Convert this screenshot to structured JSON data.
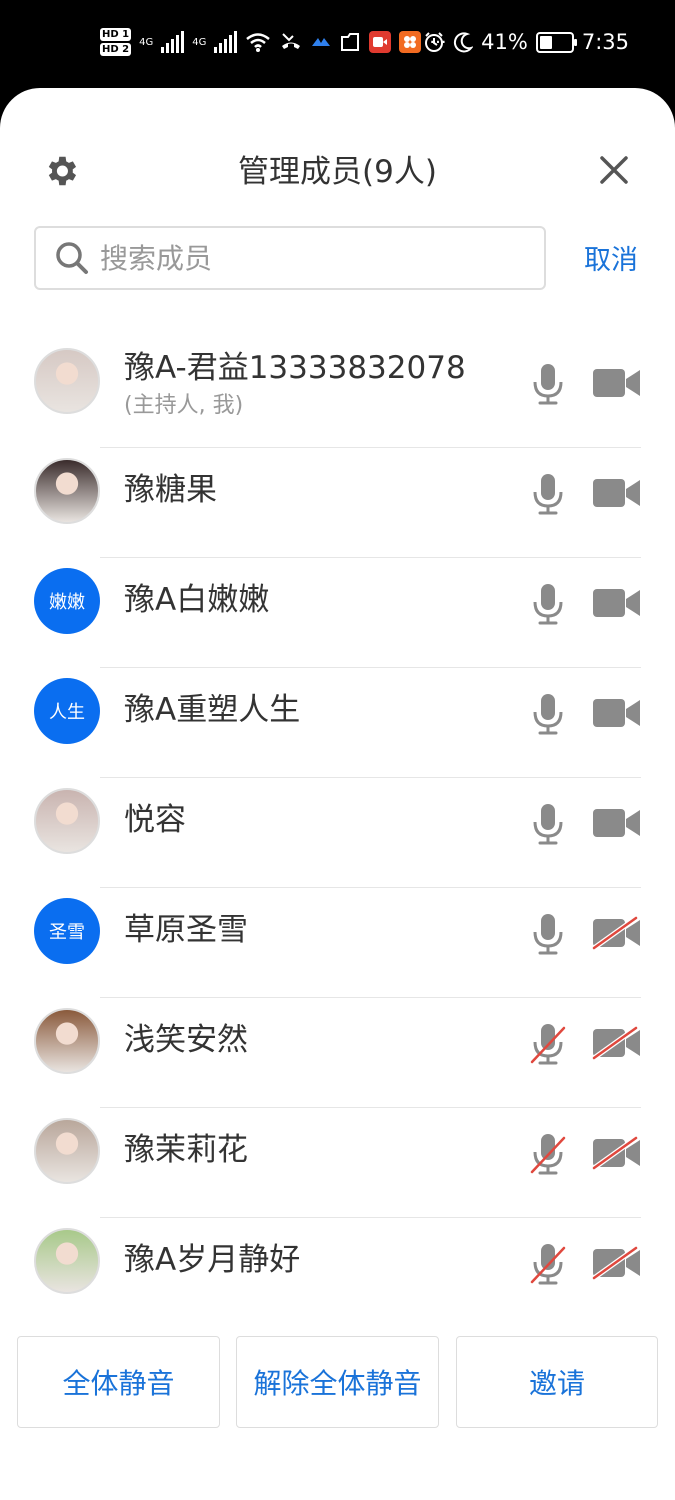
{
  "status_bar": {
    "hd1": "HD 1",
    "hd2": "HD 2",
    "net1": "4G",
    "net2": "4G",
    "more": "···",
    "battery_percent": "41%",
    "battery_level": 0.41,
    "time": "7:35",
    "icons": [
      "signal-icon",
      "wifi-icon",
      "missed-call-icon",
      "app-icon",
      "folder-icon",
      "video-app-icon",
      "app-icon",
      "alarm-icon",
      "moon-icon",
      "battery-icon"
    ]
  },
  "header": {
    "title": "管理成员(9人)",
    "settings_icon": "gear-icon",
    "close_icon": "close-icon"
  },
  "search": {
    "placeholder": "搜索成员",
    "cancel_label": "取消"
  },
  "members": [
    {
      "name": "豫A-君益13333832078",
      "sub": "(主持人, 我)",
      "avatar_type": "photo",
      "avatar_text": "",
      "mic_on": true,
      "cam_on": true
    },
    {
      "name": "豫糖果",
      "sub": "",
      "avatar_type": "photo",
      "avatar_text": "",
      "mic_on": true,
      "cam_on": true
    },
    {
      "name": "豫A白嫩嫩",
      "sub": "",
      "avatar_type": "text",
      "avatar_text": "嫩嫩",
      "mic_on": true,
      "cam_on": true
    },
    {
      "name": "豫A重塑人生",
      "sub": "",
      "avatar_type": "text",
      "avatar_text": "人生",
      "mic_on": true,
      "cam_on": true
    },
    {
      "name": "悦容",
      "sub": "",
      "avatar_type": "photo",
      "avatar_text": "",
      "mic_on": true,
      "cam_on": true
    },
    {
      "name": "草原圣雪",
      "sub": "",
      "avatar_type": "text",
      "avatar_text": "圣雪",
      "mic_on": true,
      "cam_on": false
    },
    {
      "name": "浅笑安然",
      "sub": "",
      "avatar_type": "photo",
      "avatar_text": "",
      "mic_on": false,
      "cam_on": false
    },
    {
      "name": "豫茉莉花",
      "sub": "",
      "avatar_type": "photo",
      "avatar_text": "",
      "mic_on": false,
      "cam_on": false
    },
    {
      "name": "豫A岁月静好",
      "sub": "",
      "avatar_type": "photo",
      "avatar_text": "",
      "mic_on": false,
      "cam_on": false
    }
  ],
  "footer": {
    "mute_all": "全体静音",
    "unmute_all": "解除全体静音",
    "invite": "邀请"
  },
  "colors": {
    "accent": "#1a73d9",
    "avatar_blue": "#0a6ef0",
    "icon_gray": "#8a8a8a",
    "off_red": "#e0483e"
  }
}
